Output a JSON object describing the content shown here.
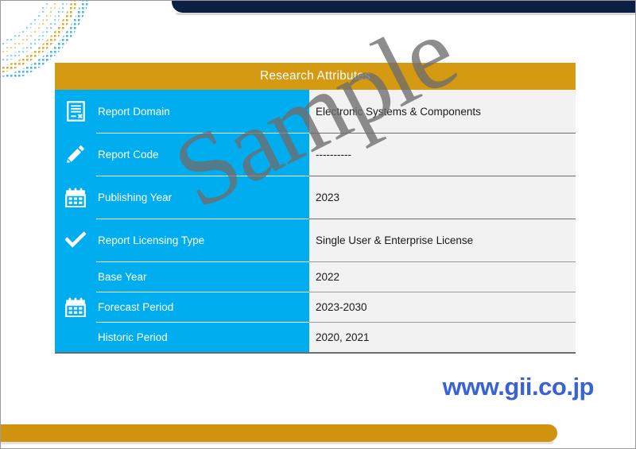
{
  "slide": {
    "title": "Research Attributes",
    "url": "www.gii.co.jp",
    "watermark": "Sample"
  },
  "colors": {
    "header_gold": "#d59a12",
    "label_blue": "#00AEEF",
    "value_gray": "#f2f2f2",
    "top_bar_navy": "#0b1f42",
    "bottom_bar_gold": "#cf9310",
    "url_blue": "#3a62d8",
    "watermark_gray": "#6d6d6d"
  },
  "table": {
    "header": "Research Attributes",
    "rows": [
      {
        "icon": "document-icon",
        "label": "Report Domain",
        "value": "Electronic Systems & Components"
      },
      {
        "icon": "pencil-icon",
        "label": "Report Code",
        "value": "----------"
      },
      {
        "icon": "calendar-icon",
        "label": "Publishing Year",
        "value": "2023"
      },
      {
        "icon": "check-icon",
        "label": "Report Licensing Type",
        "value": "Single User & Enterprise License"
      }
    ],
    "group": {
      "icon": "calendar-icon",
      "sub_rows": [
        {
          "label": "Base Year",
          "value": "2022"
        },
        {
          "label": "Forecast Period",
          "value": "2023-2030"
        },
        {
          "label": "Historic Period",
          "value": "2020, 2021"
        }
      ]
    }
  }
}
